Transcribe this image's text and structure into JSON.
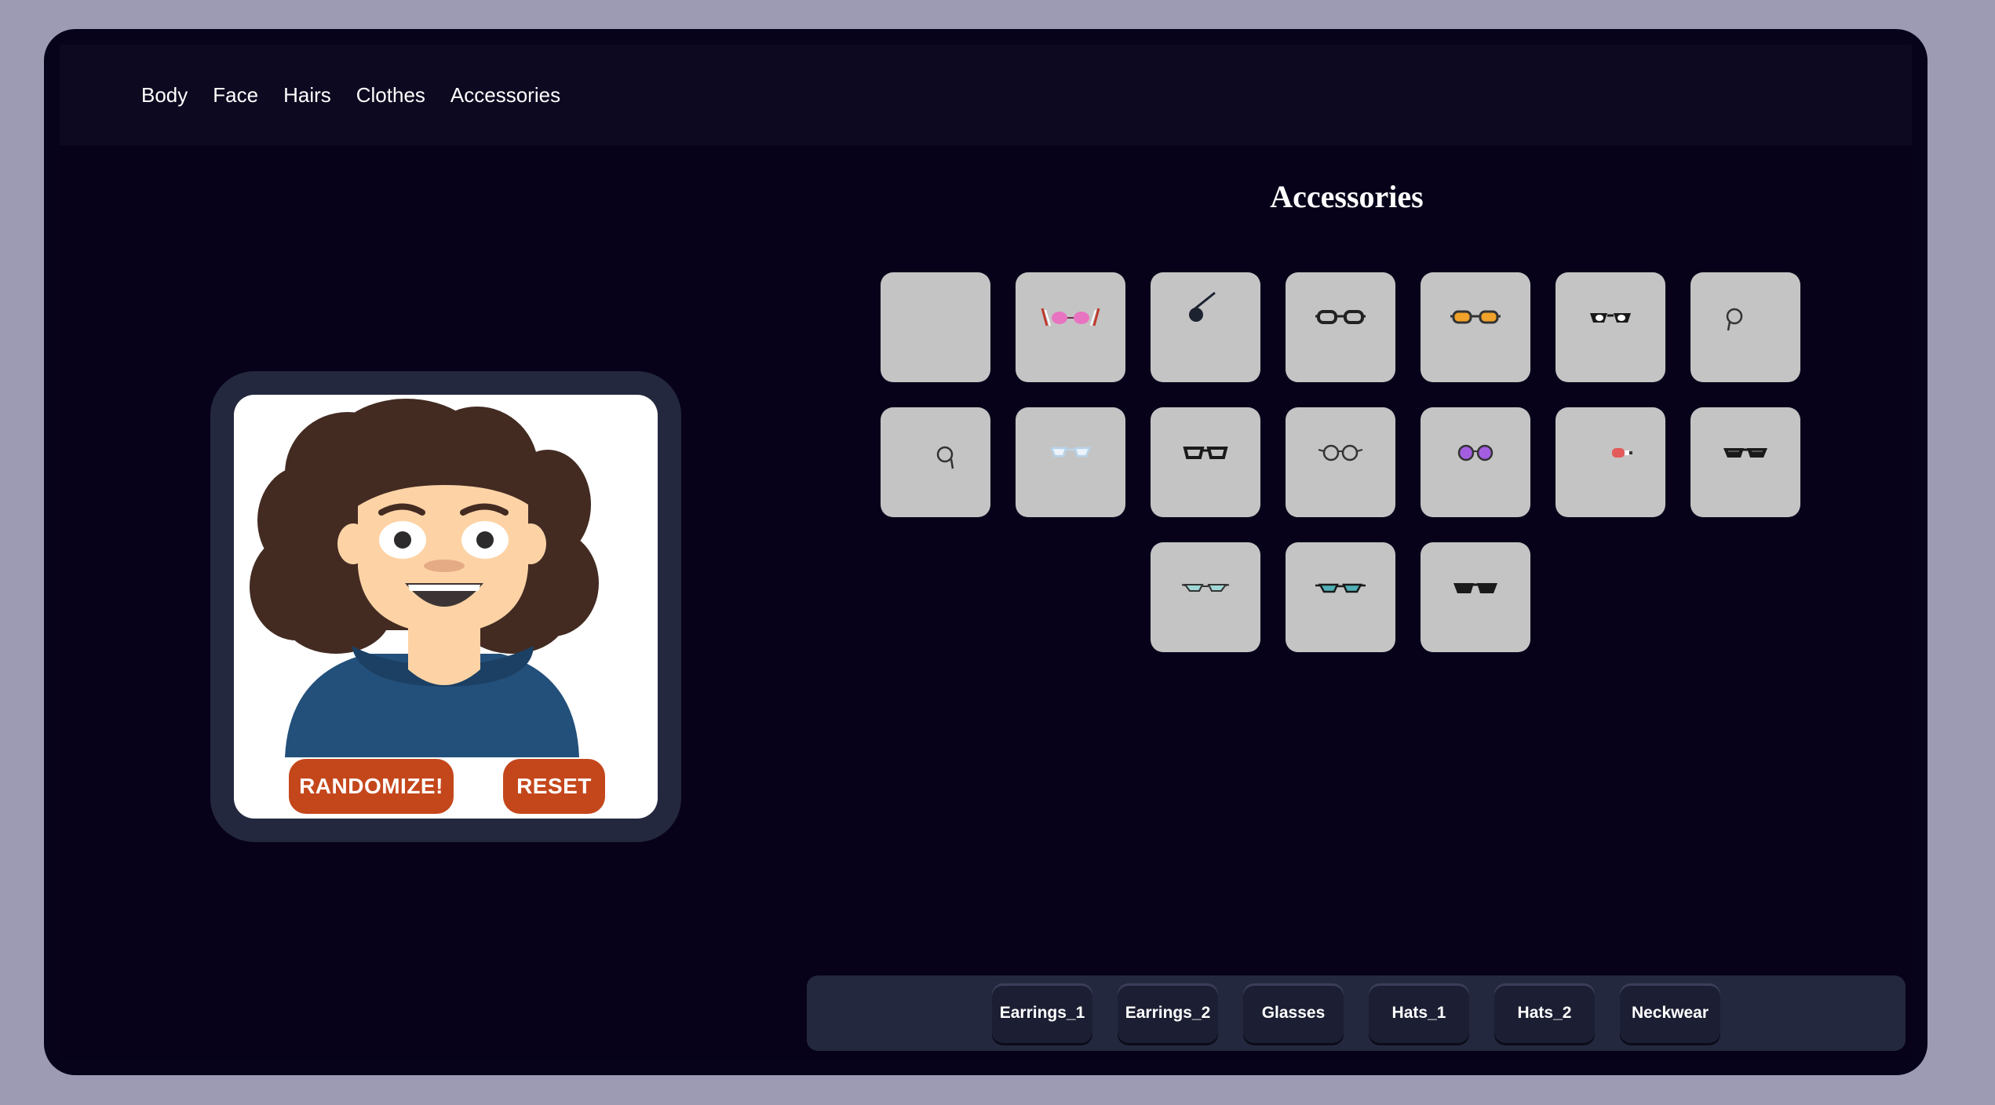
{
  "nav": {
    "items": [
      {
        "label": "Body"
      },
      {
        "label": "Face"
      },
      {
        "label": "Hairs"
      },
      {
        "label": "Clothes"
      },
      {
        "label": "Accessories"
      }
    ]
  },
  "avatar": {
    "randomize_label": "RANDOMIZE!",
    "reset_label": "RESET",
    "colors": {
      "hair": "#432b22",
      "skin": "#fdd3a6",
      "shirt": "#23507a",
      "button": "#c4471c"
    }
  },
  "accessories": {
    "title": "Accessories",
    "options": [
      {
        "icon": "none"
      },
      {
        "icon": "pink-heart-glasses-icon"
      },
      {
        "icon": "eyepatch-icon"
      },
      {
        "icon": "rectangle-glasses-icon"
      },
      {
        "icon": "orange-glasses-icon"
      },
      {
        "icon": "white-cateye-glasses-icon"
      },
      {
        "icon": "monocle-left-icon"
      },
      {
        "icon": "monocle-right-icon"
      },
      {
        "icon": "clear-glasses-icon"
      },
      {
        "icon": "black-round-glasses-icon"
      },
      {
        "icon": "thin-round-glasses-icon"
      },
      {
        "icon": "purple-round-glasses-icon"
      },
      {
        "icon": "red-eyepiece-icon"
      },
      {
        "icon": "black-sunglasses-icon"
      },
      {
        "icon": "teal-cateye-glasses-icon"
      },
      {
        "icon": "teal-glasses-icon"
      },
      {
        "icon": "dark-sunglasses-icon"
      }
    ]
  },
  "categories": [
    {
      "label": "Earrings_1"
    },
    {
      "label": "Earrings_2"
    },
    {
      "label": "Glasses"
    },
    {
      "label": "Hats_1"
    },
    {
      "label": "Hats_2"
    },
    {
      "label": "Neckwear"
    }
  ]
}
